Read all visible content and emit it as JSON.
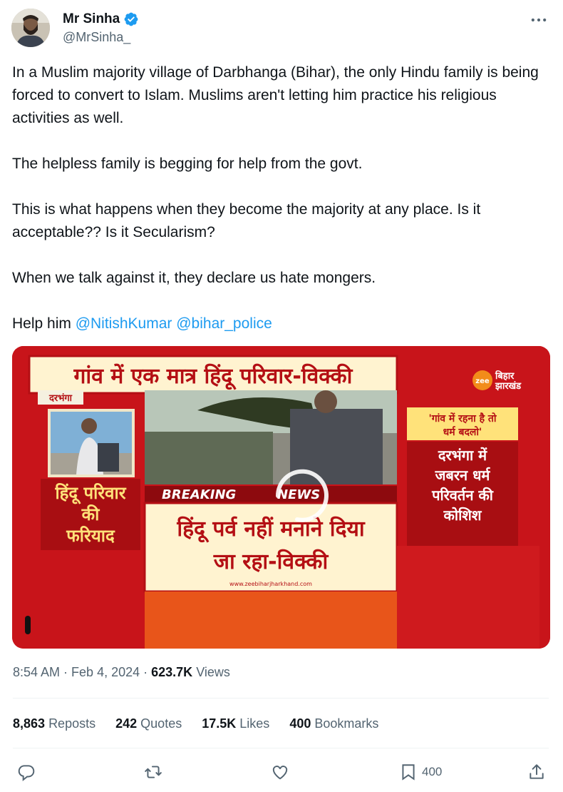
{
  "author": {
    "display_name": "Mr Sinha",
    "handle": "@MrSinha_",
    "verified": true,
    "avatar_icon": "user-avatar"
  },
  "tweet": {
    "paragraphs": [
      "In a Muslim majority village of Darbhanga (Bihar), the only Hindu family is being forced to convert to Islam. Muslims aren't letting him practice his religious activities as well.",
      "The helpless family is begging for help from the govt.",
      "This is what happens when they become the majority at any place. Is it acceptable?? Is it Secularism?",
      "When we talk against it, they declare us hate mongers."
    ],
    "help_prefix": "Help him ",
    "mention_1": "@NitishKumar",
    "mention_2": "@bihar_police"
  },
  "video": {
    "top_banner": "गांव में एक मात्र हिंदू परिवार-विक्की",
    "location_tag": "दरभंगा",
    "left_caption_line1": "हिंदू परिवार",
    "left_caption_line2": "की",
    "left_caption_line3": "फरियाद",
    "breaking": "BREAKING",
    "news": "NEWS",
    "main_caption_line1": "हिंदू पर्व नहीं मनाने दिया",
    "main_caption_line2": "जा रहा-विक्की",
    "website": "www.zeebiharjharkhand.com",
    "channel_logo_line1": "बिहार",
    "channel_logo_line2": "झारखंड",
    "channel_zee": "zee",
    "right_quote_line1": "'गांव में रहना है तो",
    "right_quote_line2": "धर्म बदलो'",
    "right_caption_line1": "दरभंगा में",
    "right_caption_line2": "जबरन धर्म",
    "right_caption_line3": "परिवर्तन की",
    "right_caption_line4": "कोशिश"
  },
  "meta": {
    "time": "8:54 AM",
    "date": "Feb 4, 2024",
    "views_count": "623.7K",
    "views_label": "Views"
  },
  "stats": {
    "reposts_count": "8,863",
    "reposts_label": "Reposts",
    "quotes_count": "242",
    "quotes_label": "Quotes",
    "likes_count": "17.5K",
    "likes_label": "Likes",
    "bookmarks_count": "400",
    "bookmarks_label": "Bookmarks"
  },
  "actions": {
    "reply_icon": "reply-icon",
    "repost_icon": "repost-icon",
    "like_icon": "heart-icon",
    "bookmark_icon": "bookmark-icon",
    "bookmark_count": "400",
    "share_icon": "share-icon"
  },
  "colors": {
    "link": "#1d9bf0",
    "verified": "#1d9bf0",
    "secondary_text": "#536471",
    "video_red": "#c8141a",
    "caption_yellow": "#ffe27a"
  }
}
